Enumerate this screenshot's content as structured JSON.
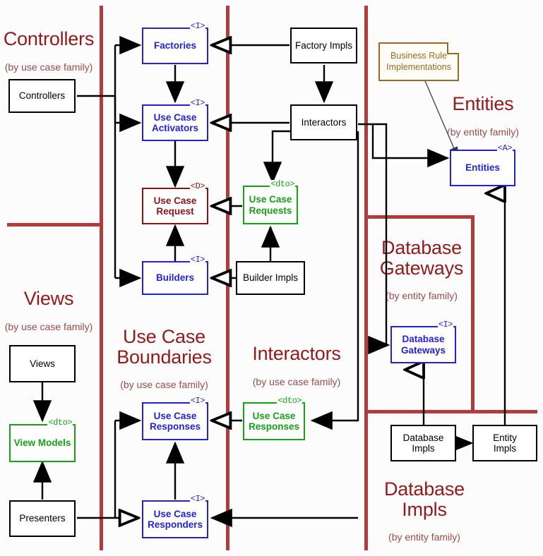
{
  "diagram": {
    "title": "Clean Architecture package/component diagram",
    "colors": {
      "region_divider": "#b23b3b",
      "region_heading": "#941a1a",
      "interface": "#2222dd",
      "dto": "#14a314",
      "data_structure": "#8c1414",
      "impl": "#000000",
      "note": "#9c6b1c"
    }
  },
  "regions": [
    {
      "name": "controllers",
      "title": "Controllers",
      "subtitle": "(by use case family)"
    },
    {
      "name": "views",
      "title": "Views",
      "subtitle": "(by use case family)"
    },
    {
      "name": "use-case-boundaries",
      "title": "Use Case\nBoundaries",
      "subtitle": "(by use case family)"
    },
    {
      "name": "interactors",
      "title": "Interactors",
      "subtitle": "(by use case family)"
    },
    {
      "name": "entities",
      "title": "Entities",
      "subtitle": "(by entity family)"
    },
    {
      "name": "database-gateways",
      "title": "Database\nGateways",
      "subtitle": "(by entity family)"
    },
    {
      "name": "database-impls",
      "title": "Database\nImpls",
      "subtitle": "(by entity family)"
    }
  ],
  "boxes": {
    "controllers": {
      "label": "Controllers",
      "stereotype": "",
      "kind": "impl"
    },
    "factories": {
      "label": "Factories",
      "stereotype": "<I>",
      "kind": "interface"
    },
    "use_case_activators": {
      "label": "Use Case\nActivators",
      "stereotype": "<I>",
      "kind": "interface"
    },
    "use_case_request": {
      "label": "Use Case\nRequest",
      "stereotype": "<D>",
      "kind": "data_structure"
    },
    "builders": {
      "label": "Builders",
      "stereotype": "<I>",
      "kind": "interface"
    },
    "factory_impls": {
      "label": "Factory Impls",
      "stereotype": "",
      "kind": "impl"
    },
    "interactors": {
      "label": "Interactors",
      "stereotype": "",
      "kind": "impl"
    },
    "use_case_requests": {
      "label": "Use Case\nRequests",
      "stereotype": "<dto>",
      "kind": "dto"
    },
    "builder_impls": {
      "label": "Builder Impls",
      "stereotype": "",
      "kind": "impl"
    },
    "entities": {
      "label": "Entities",
      "stereotype": "<A>",
      "kind": "interface"
    },
    "database_gateways": {
      "label": "Database\nGateways",
      "stereotype": "<I>",
      "kind": "interface"
    },
    "database_impls": {
      "label": "Database\nImpls",
      "stereotype": "",
      "kind": "impl"
    },
    "entity_impls": {
      "label": "Entity\nImpls",
      "stereotype": "",
      "kind": "impl"
    },
    "views": {
      "label": "Views",
      "stereotype": "",
      "kind": "impl"
    },
    "view_models": {
      "label": "View Models",
      "stereotype": "<dto>",
      "kind": "dto"
    },
    "presenters": {
      "label": "Presenters",
      "stereotype": "",
      "kind": "impl"
    },
    "use_case_responses_i": {
      "label": "Use Case\nResponses",
      "stereotype": "<I>",
      "kind": "interface"
    },
    "use_case_responses_d": {
      "label": "Use Case\nResponses",
      "stereotype": "<dto>",
      "kind": "dto"
    },
    "use_case_responders": {
      "label": "Use Case\nResponders",
      "stereotype": "<I>",
      "kind": "interface"
    }
  },
  "note": {
    "label": "Business Rule\nImplementations"
  }
}
